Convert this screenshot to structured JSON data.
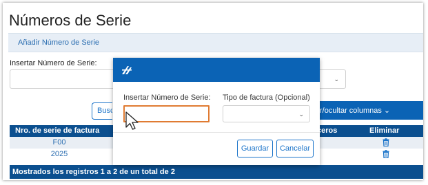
{
  "page": {
    "title": "Números de Serie",
    "tab_add": "Añadir Número de Serie",
    "insert_label": "Insertar Número de Serie:"
  },
  "toolbar": {
    "search_label": "Busc",
    "columns_label": "r/ocultar columnas ⌄"
  },
  "table": {
    "headers": {
      "serie": "Nro. de serie de factura",
      "ceros": "ceros",
      "eliminar": "Eliminar"
    },
    "rows": [
      {
        "serie": "F00"
      },
      {
        "serie": "2025"
      }
    ],
    "footer": "Mostrados los registros 1 a 2 de un total de 2"
  },
  "modal": {
    "label_serie": "Insertar Número de Serie:",
    "label_tipo": "Tipo de factura (Opcional)",
    "input_value": "",
    "select_value": "",
    "save": "Guardar",
    "cancel": "Cancelar"
  },
  "icons": {
    "logo": "agency-logo-icon",
    "delete": "trash-icon",
    "dropdown": "chevron-down-icon",
    "cursor": "mouse-pointer-icon"
  },
  "colors": {
    "header_blue": "#0b4f8f",
    "modal_header": "#0b63b5",
    "link_blue": "#1a73c9",
    "input_focus": "#e07b32"
  }
}
